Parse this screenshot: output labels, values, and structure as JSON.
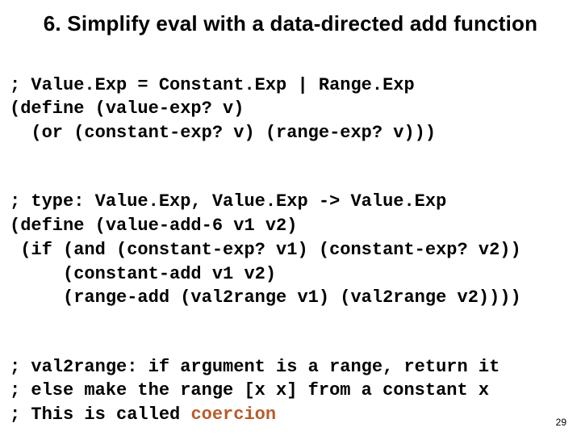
{
  "title": "6. Simplify eval with a data-directed add function",
  "block1": {
    "l1": "; Value.Exp = Constant.Exp | Range.Exp",
    "l2": "(define (value-exp? v)",
    "l3": "  (or (constant-exp? v) (range-exp? v)))"
  },
  "block2": {
    "l1": "; type: Value.Exp, Value.Exp -> Value.Exp",
    "l2": "(define (value-add-6 v1 v2)",
    "l3": " (if (and (constant-exp? v1) (constant-exp? v2))",
    "l4": "     (constant-add v1 v2)",
    "l5": "     (range-add (val2range v1) (val2range v2))))"
  },
  "block3": {
    "l1": "; val2range: if argument is a range, return it",
    "l2": "; else make the range [x x] from a constant x",
    "l3_pre": "; This is called ",
    "l3_em": "coercion"
  },
  "pagenum": "29"
}
